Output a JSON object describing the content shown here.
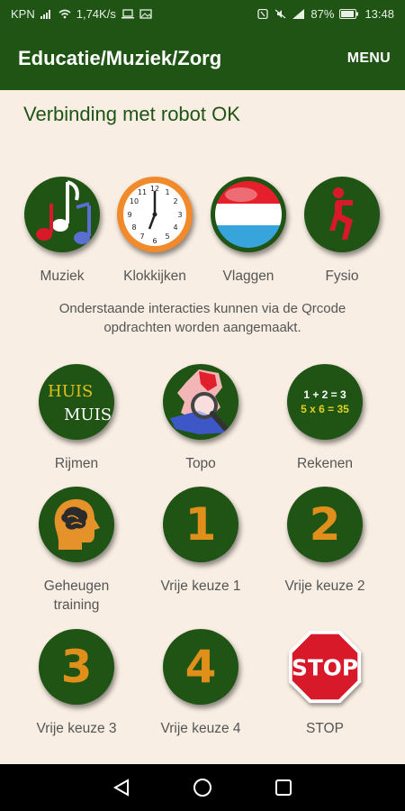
{
  "statusbar": {
    "carrier": "KPN",
    "speed": "1,74K/s",
    "battery": "87%",
    "time": "13:48"
  },
  "appbar": {
    "title": "Educatie/Muziek/Zorg",
    "menu": "MENU"
  },
  "connection_status": "Verbinding met robot OK",
  "top_tiles": [
    {
      "label": "Muziek",
      "icon": "music-notes-icon"
    },
    {
      "label": "Klokkijken",
      "icon": "clock-icon"
    },
    {
      "label": "Vlaggen",
      "icon": "flag-ball-icon"
    },
    {
      "label": "Fysio",
      "icon": "fysio-figure-icon"
    }
  ],
  "info_text": "Onderstaande interacties kunnen via de Qrcode opdrachten worden aangemaakt.",
  "grid_tiles": [
    {
      "label": "Rijmen",
      "icon": "rhyme-icon",
      "line1": "HUIS",
      "line2": "MUIS"
    },
    {
      "label": "Topo",
      "icon": "map-magnifier-icon"
    },
    {
      "label": "Rekenen",
      "icon": "math-icon",
      "line1": "1 + 2 = 3",
      "line2": "5 x 6 = 35"
    },
    {
      "label": "Geheugen training",
      "label_line1": "Geheugen",
      "label_line2": "training",
      "icon": "brain-head-icon"
    },
    {
      "label": "Vrije keuze 1",
      "icon": "number-1-icon",
      "num": "1"
    },
    {
      "label": "Vrije keuze 2",
      "icon": "number-2-icon",
      "num": "2"
    },
    {
      "label": "Vrije keuze 3",
      "icon": "number-3-icon",
      "num": "3"
    },
    {
      "label": "Vrije keuze 4",
      "icon": "number-4-icon",
      "num": "4"
    },
    {
      "label": "STOP",
      "icon": "stop-sign-icon",
      "sign_text": "STOP"
    }
  ],
  "colors": {
    "primary": "#1f5415",
    "background": "#f8eee3",
    "accent_number": "#e0901a",
    "stop_red": "#d7192a"
  }
}
